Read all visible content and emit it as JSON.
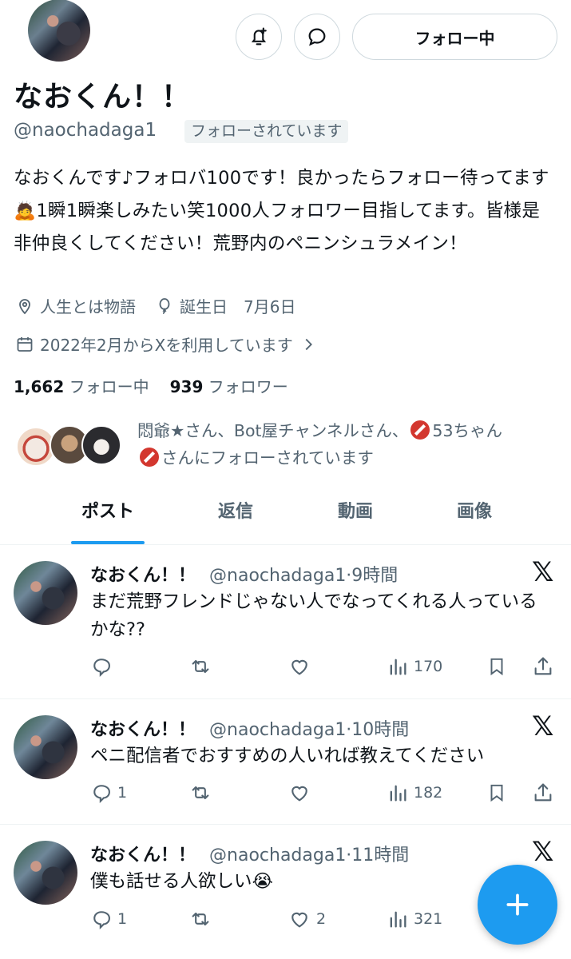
{
  "profile": {
    "display_name": "なおくん！！",
    "handle": "@naochadaga1",
    "follows_you_badge": "フォローされています",
    "bio": "なおくんです♪フォロバ100です！良かったらフォロー待ってます🙇1瞬1瞬楽しみたい笑1000人フォロワー目指してます。皆様是非仲良くしてください！荒野内のペニンシュラメイン！",
    "location": "人生とは物語",
    "birthday": "誕生日　7月6日",
    "joined": "2022年2月からXを利用しています",
    "following_count": "1,662",
    "following_label": "フォロー中",
    "followers_count": "939",
    "followers_label": "フォロワー",
    "followed_by_part1": "悶爺★さん、Bot屋チャンネルさん、",
    "followed_by_part2": "53ちゃん",
    "followed_by_part3": "さんにフォローされています"
  },
  "header_buttons": {
    "follow_label": "フォロー中"
  },
  "tabs": [
    {
      "label": "ポスト",
      "active": true
    },
    {
      "label": "返信",
      "active": false
    },
    {
      "label": "動画",
      "active": false
    },
    {
      "label": "画像",
      "active": false
    }
  ],
  "tweets": [
    {
      "name": "なおくん！！",
      "handle_time": "@naochadaga1·9時間",
      "text": "まだ荒野フレンドじゃない人でなってくれる人っているかな??",
      "replies": "",
      "likes": "",
      "views": "170"
    },
    {
      "name": "なおくん！！",
      "handle_time": "@naochadaga1·10時間",
      "text": "ペニ配信者でおすすめの人いれば教えてください",
      "replies": "1",
      "likes": "",
      "views": "182"
    },
    {
      "name": "なおくん！！",
      "handle_time": "@naochadaga1·11時間",
      "text": "僕も話せる人欲しい😭",
      "replies": "1",
      "likes": "2",
      "views": "321"
    }
  ],
  "colors": {
    "accent": "#1d9bf0",
    "text_primary": "#0f1419",
    "text_secondary": "#536471"
  },
  "icons": [
    "notification-bell-plus-icon",
    "message-bubble-icon",
    "location-pin-icon",
    "balloon-icon",
    "calendar-icon",
    "chevron-right-icon",
    "reply-icon",
    "repost-icon",
    "like-icon",
    "views-icon",
    "bookmark-icon",
    "share-icon",
    "x-logo-icon",
    "compose-plus-icon"
  ]
}
